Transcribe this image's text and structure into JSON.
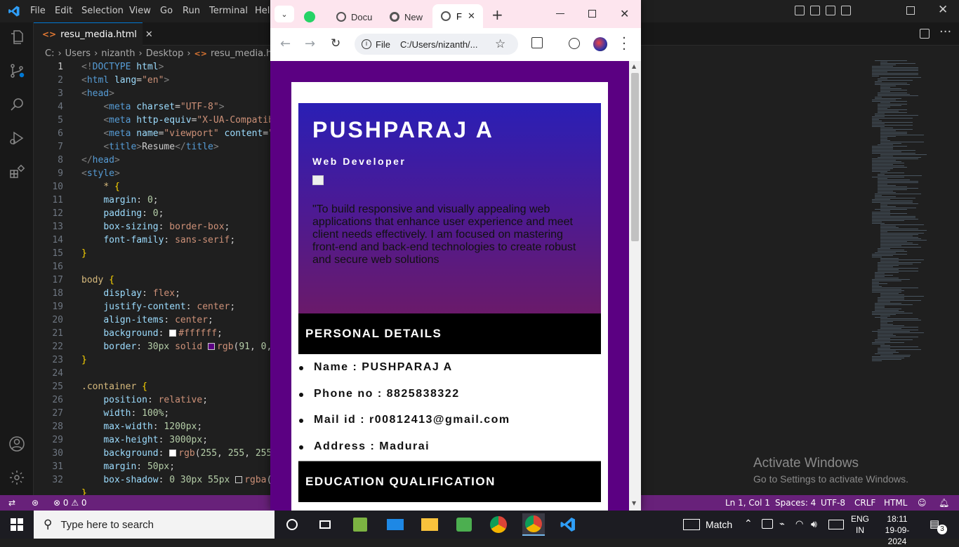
{
  "vscode": {
    "menu": [
      "File",
      "Edit",
      "Selection",
      "View",
      "Go",
      "Run",
      "Terminal",
      "Help"
    ],
    "tab": {
      "filename": "resu_media.html"
    },
    "breadcrumb": [
      "C:",
      "Users",
      "nizanth",
      "Desktop",
      "resu_media.html"
    ],
    "line_numbers": [
      "1",
      "2",
      "3",
      "4",
      "5",
      "6",
      "7",
      "8",
      "9",
      "10",
      "11",
      "12",
      "13",
      "14",
      "15",
      "16",
      "17",
      "18",
      "19",
      "20",
      "21",
      "22",
      "23",
      "24",
      "25",
      "26",
      "27",
      "28",
      "29",
      "30",
      "31",
      "32"
    ],
    "status": {
      "errors": "0",
      "warnings": "0",
      "position": "Ln 1, Col 1",
      "spaces": "Spaces: 4",
      "encoding": "UTF-8",
      "eol": "CRLF",
      "language": "HTML"
    },
    "watermark": {
      "title": "Activate Windows",
      "subtitle": "Go to Settings to activate Windows."
    }
  },
  "chrome": {
    "tabs": [
      {
        "label": "Docu"
      },
      {
        "label": "New"
      },
      {
        "label": "F"
      }
    ],
    "omnibox": {
      "scheme": "File",
      "url": "C:/Users/nizanth/..."
    },
    "page": {
      "name": "PUSHPARAJ A",
      "role": "Web Developer",
      "objective": "\"To build responsive and visually appealing web applications that enhance user experience and meet client needs effectively. I am focused on mastering front-end and back-end technologies to create robust and secure web solutions",
      "personal_heading": "PERSONAL DETAILS",
      "details": [
        "Name : PUSHPARAJ A",
        "Phone no : 8825838322",
        "Mail id : r00812413@gmail.com",
        "Address : Madurai"
      ],
      "education_heading": "EDUCATION QUALIFICATION"
    }
  },
  "taskbar": {
    "search_placeholder": "Type here to search",
    "match": "Match",
    "lang_top": "ENG",
    "lang_bottom": "IN",
    "time": "18:11",
    "date": "19-09-2024",
    "notifications": "3"
  },
  "colors": {
    "statusbar": "#68217a",
    "page_border": "#5b0082",
    "accent": "#0078d4"
  }
}
